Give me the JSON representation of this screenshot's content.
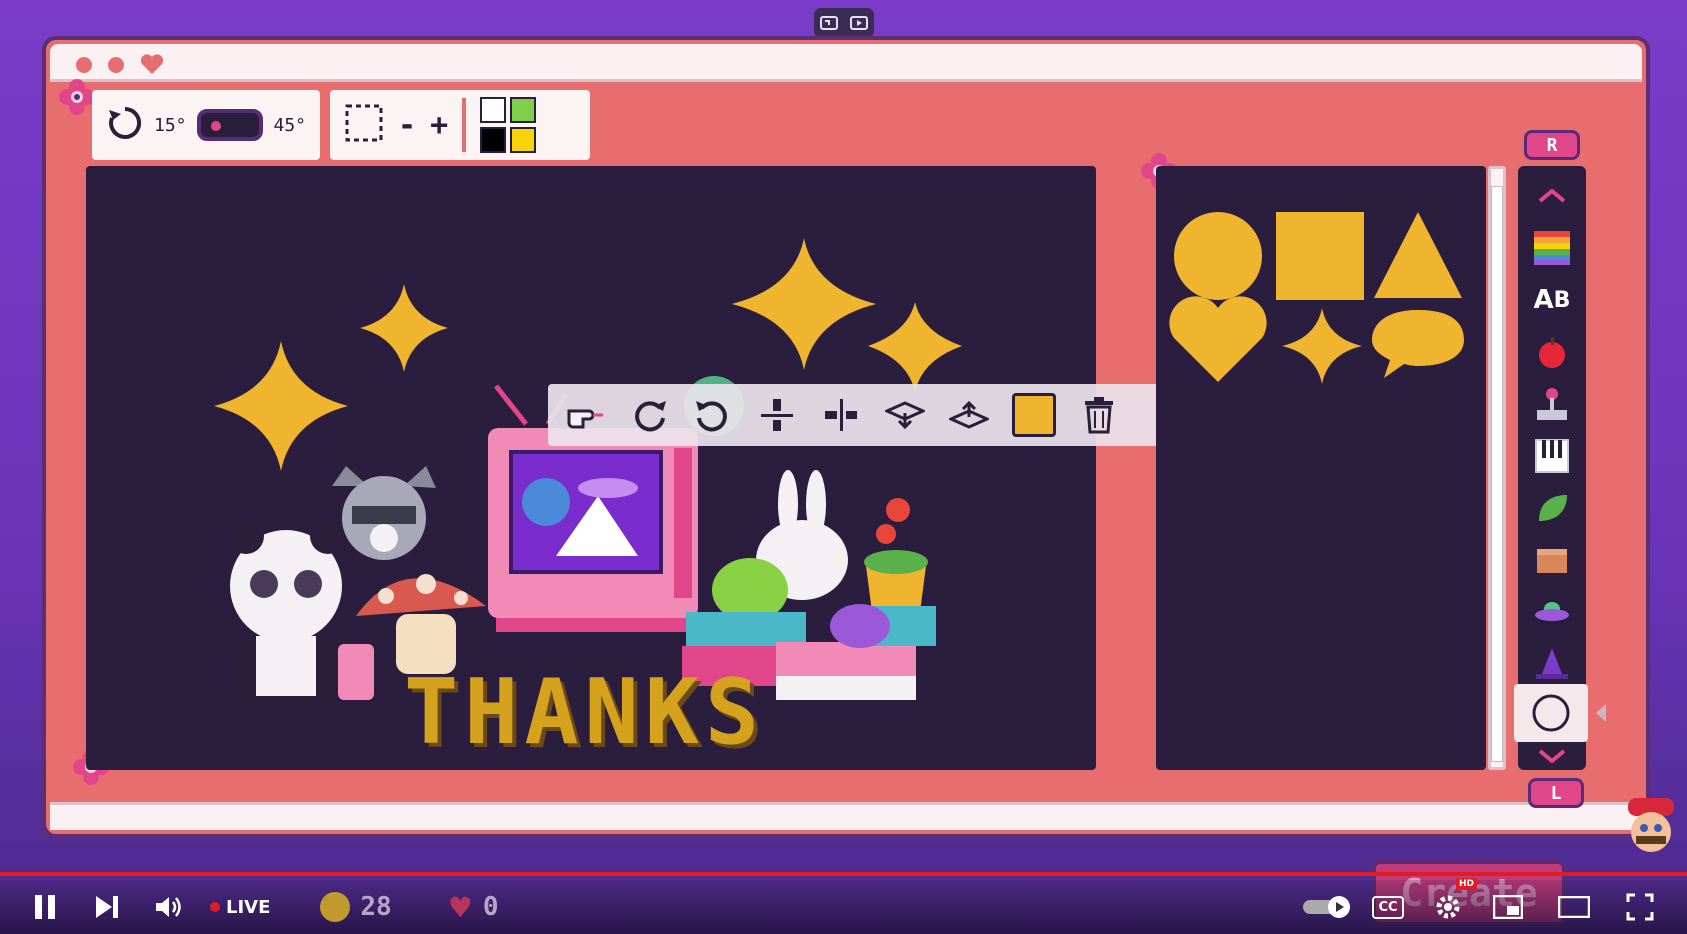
{
  "capture": {
    "icon_left": "screenshot-icon",
    "icon_right": "record-icon"
  },
  "rotation": {
    "small_angle": "15°",
    "large_angle": "45°"
  },
  "selection": {
    "minus": "-",
    "plus": "+"
  },
  "palette": [
    "#ffffff",
    "#7ecf4a",
    "#000000",
    "#f7d40a"
  ],
  "canvas": {
    "text": "THANKS"
  },
  "context_toolbar": {
    "items": [
      "pointer-hand-icon",
      "rotate-left-icon",
      "rotate-right-icon",
      "flip-vertical-icon",
      "flip-horizontal-icon",
      "layer-down-icon",
      "layer-up-icon",
      "color-swatch",
      "trash-icon"
    ],
    "color": "#efb52f"
  },
  "shapes": [
    "circle",
    "square",
    "triangle",
    "heart",
    "sparkle",
    "speech-bubble"
  ],
  "categories": {
    "top_tag": "R",
    "bottom_tag": "L",
    "items": [
      "rainbow-icon",
      "text-icon",
      "apple-icon",
      "joystick-icon",
      "piano-icon",
      "leaf-icon",
      "box-icon",
      "ufo-icon",
      "witch-hat-icon"
    ],
    "selected": "circle-outline-icon"
  },
  "hud": {
    "coins": "28",
    "hearts": "0"
  },
  "player": {
    "live": "LIVE",
    "hd": "HD",
    "cc": "CC"
  },
  "create_button": "Create",
  "colors": {
    "window": "#e86d6f",
    "canvas": "#2a1d3d",
    "gold": "#efb52f",
    "pink": "#e2468a",
    "purple": "#5a2c78"
  }
}
